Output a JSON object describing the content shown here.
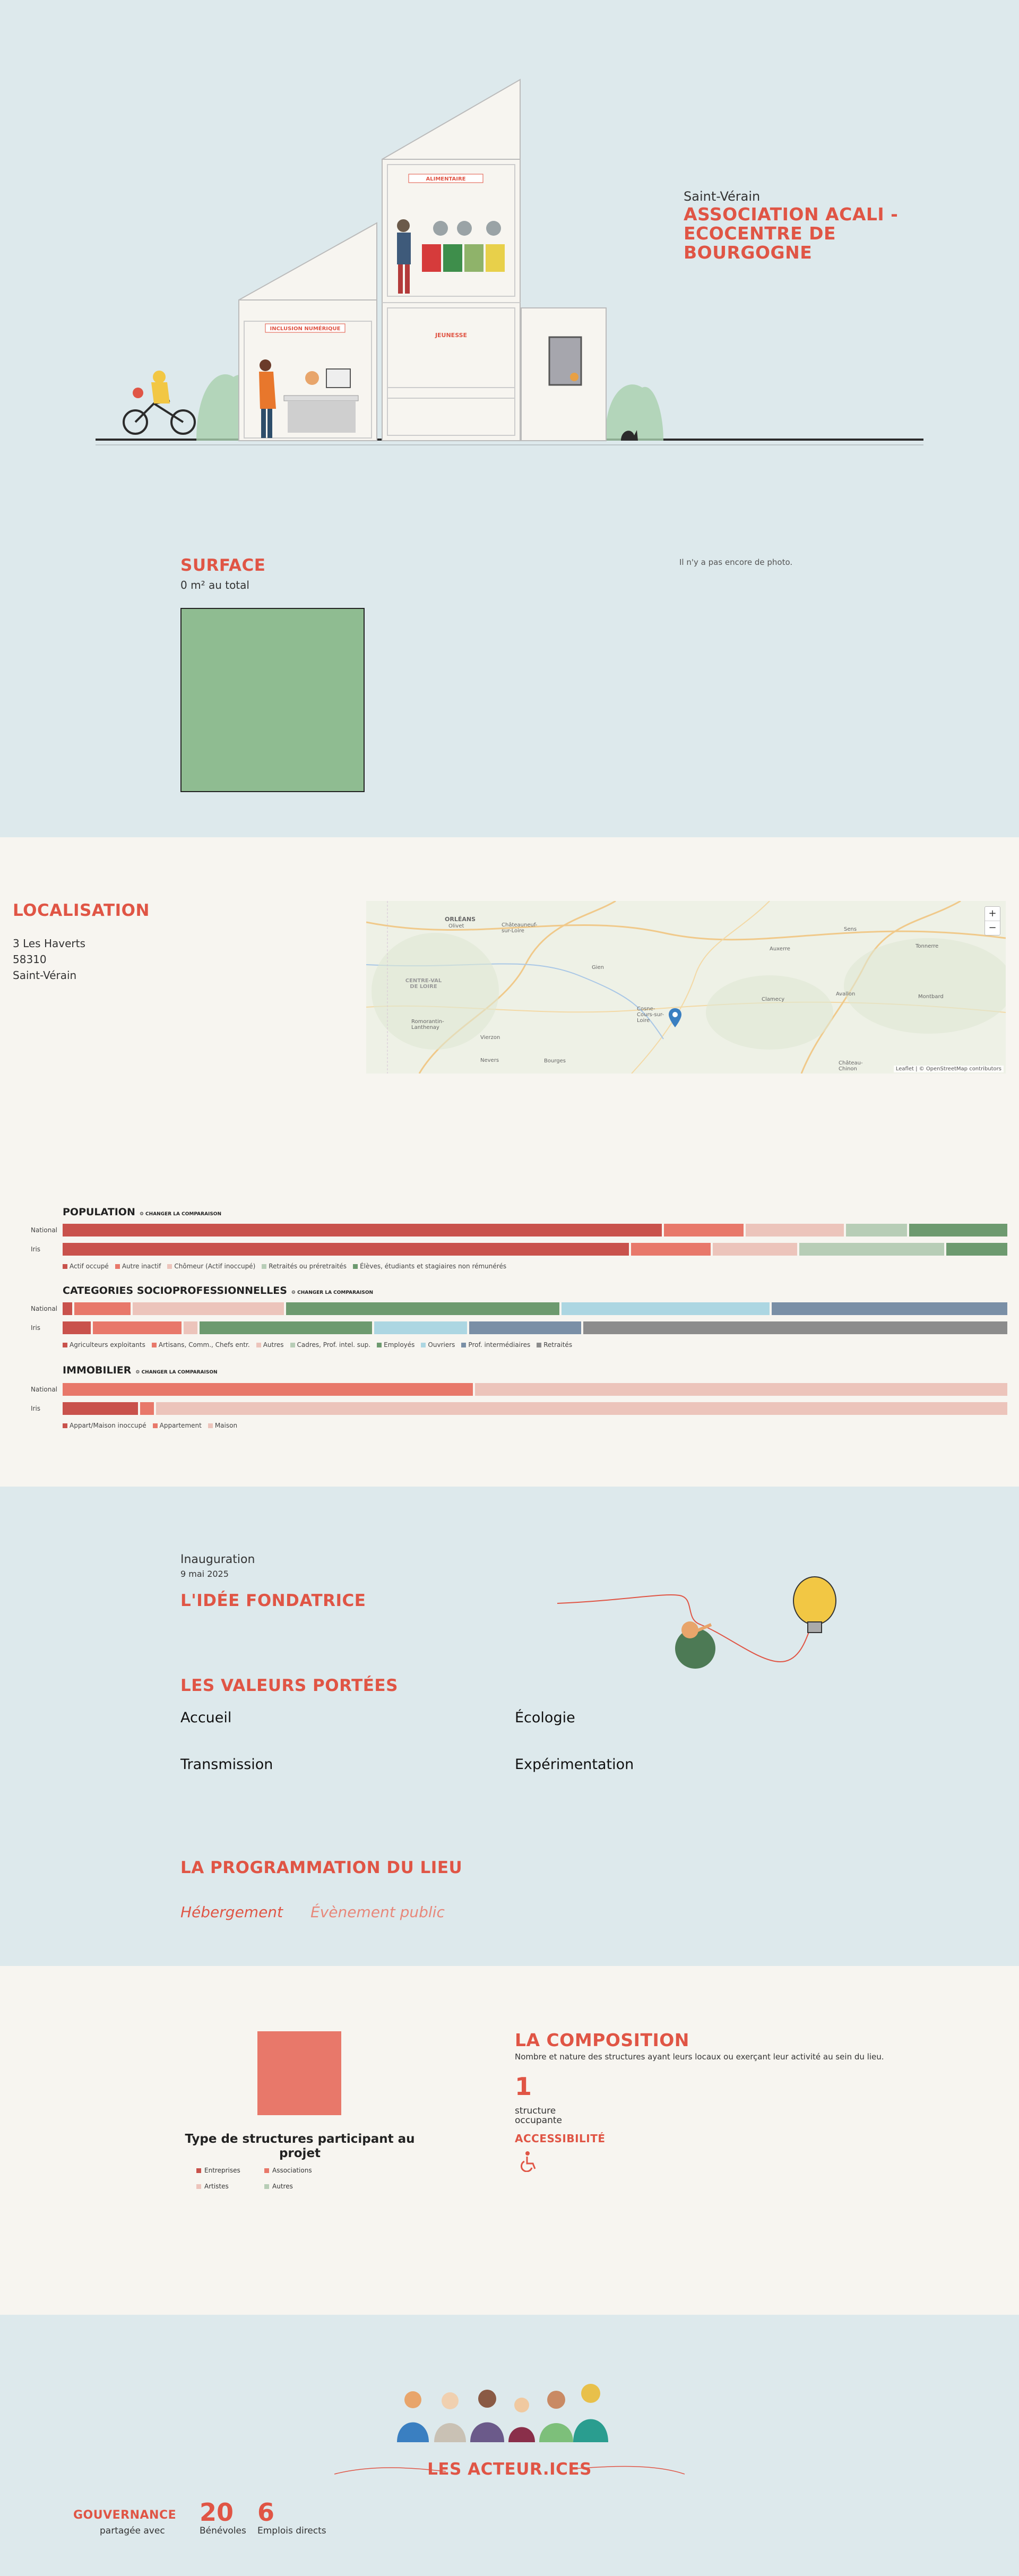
{
  "hero": {
    "city": "Saint-Vérain",
    "name": "ASSOCIATION ACALI - ECOCENTRE DE BOURGOGNE",
    "building_labels": [
      "ALIMENTAIRE",
      "INCLUSION NUMÉRIQUE",
      "JEUNESSE"
    ],
    "colors": {
      "background": "#dde9ec",
      "accent": "#e05545"
    }
  },
  "surface": {
    "title": "SURFACE",
    "value": "0 m² au total",
    "no_photo": "Il n'y a pas encore de photo."
  },
  "localisation": {
    "title": "LOCALISATION",
    "address": [
      "3 Les Haverts",
      "58310",
      "Saint-Vérain"
    ],
    "map": {
      "zoom_in": "+",
      "zoom_out": "−",
      "attribution": "Leaflet | © OpenStreetMap contributors",
      "places": [
        "ORLÉANS",
        "CENTRE-VAL DE LOIRE",
        "Gien",
        "Cosne-Cours-sur-Loire",
        "Auxerre",
        "Clamecy",
        "Avallon",
        "Nevers",
        "Bourges",
        "Vierzon",
        "Romorantin-Lanthenay",
        "Châteauneuf-sur-Loire",
        "Sens",
        "Tonnerre",
        "Montbard",
        "Château-Chinon",
        "Olivet"
      ]
    }
  },
  "stats": {
    "change_label": "⚙ CHANGER LA COMPARAISON",
    "row_labels": [
      "National",
      "Iris"
    ],
    "population": {
      "title": "POPULATION",
      "legend": [
        {
          "label": "Actif occupé",
          "color": "#c9524c"
        },
        {
          "label": "Autre inactif",
          "color": "#e8786a"
        },
        {
          "label": "Chômeur (Actif inoccupé)",
          "color": "#ecc4bb"
        },
        {
          "label": "Retraités ou préretraités",
          "color": "#b7cdb6"
        },
        {
          "label": "Élèves, étudiants et stagiaires non rémunérés",
          "color": "#6d9a6f"
        }
      ],
      "national": [
        64,
        8.5,
        10.5,
        6.5,
        10.5
      ],
      "iris": [
        60.5,
        8.5,
        9,
        15.5,
        6.5
      ]
    },
    "csp": {
      "title": "CATEGORIES SOCIOPROFESSIONNELLES",
      "legend": [
        {
          "label": "Agriculteurs exploitants",
          "color": "#c9524c"
        },
        {
          "label": "Artisans, Comm., Chefs entr.",
          "color": "#e8786a"
        },
        {
          "label": "Autres",
          "color": "#ecc4bb"
        },
        {
          "label": "Cadres, Prof. intel. sup.",
          "color": "#b7cdb6"
        },
        {
          "label": "Employés",
          "color": "#6d9a6f"
        },
        {
          "label": "Ouvriers",
          "color": "#acd6e2"
        },
        {
          "label": "Prof. intermédiaires",
          "color": "#7a8fa6"
        },
        {
          "label": "Retraités",
          "color": "#8c8c8c"
        }
      ],
      "national": [
        1,
        6,
        16,
        0,
        29,
        22,
        25,
        0
      ],
      "iris": [
        3,
        9.5,
        1.5,
        0,
        18.5,
        10,
        12,
        45.5
      ]
    },
    "immobilier": {
      "title": "IMMOBILIER",
      "legend": [
        {
          "label": "Appart/Maison inoccupé",
          "color": "#c9524c"
        },
        {
          "label": "Appartement",
          "color": "#e8786a"
        },
        {
          "label": "Maison",
          "color": "#ecc4bb"
        }
      ],
      "national": [
        0,
        43.5,
        56.5
      ],
      "iris": [
        8,
        1.5,
        90.5
      ]
    }
  },
  "idea": {
    "inauguration": "Inauguration",
    "date": "9 mai 2025",
    "title": "L'IDÉE FONDATRICE",
    "values_title": "LES VALEURS PORTÉES",
    "values": [
      "Accueil",
      "Écologie",
      "Transmission",
      "Expérimentation"
    ],
    "prog_title": "LA PROGRAMMATION DU LIEU",
    "prog": [
      "Hébergement",
      "Évènement public"
    ]
  },
  "composition": {
    "type_title": "Type de structures participant au projet",
    "legend": [
      {
        "label": "Entreprises",
        "color": "#c9524c"
      },
      {
        "label": "Associations",
        "color": "#e8786a"
      },
      {
        "label": "Artistes",
        "color": "#ecc4bb"
      },
      {
        "label": "Autres",
        "color": "#b7cdb6"
      }
    ],
    "title": "LA COMPOSITION",
    "desc": "Nombre et nature des structures ayant leurs locaux ou exerçant leur activité au sein du lieu.",
    "count": "1",
    "count_label": "structure occupante",
    "access_title": "ACCESSIBILITÉ",
    "access_icon": "wheelchair-icon"
  },
  "acteurs": {
    "title": "LES ACTEUR.ICES",
    "gov_title": "GOUVERNANCE",
    "gov_sub": "partagée avec",
    "benevoles": "20",
    "benevoles_label": "Bénévoles",
    "emplois": "6",
    "emplois_label": "Emplois directs"
  }
}
